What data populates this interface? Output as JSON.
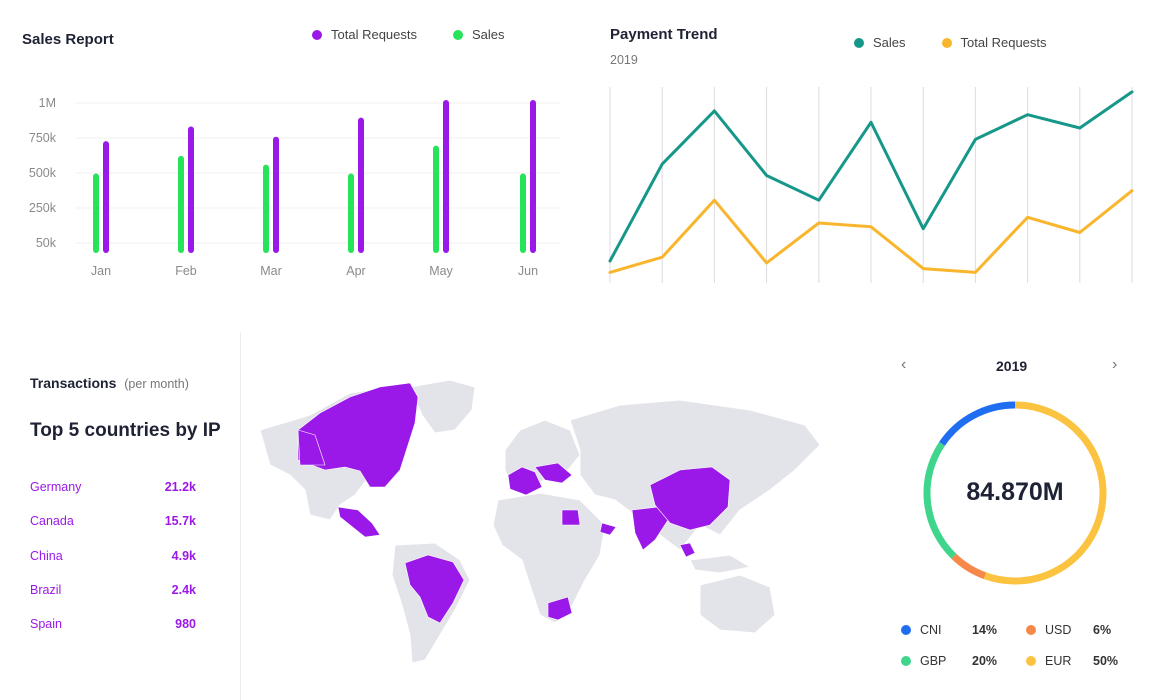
{
  "sales_report": {
    "title": "Sales Report",
    "legend": [
      {
        "label": "Total Requests",
        "color": "#9b19e8"
      },
      {
        "label": "Sales",
        "color": "#27e35a"
      }
    ]
  },
  "payment_trend": {
    "title": "Payment Trend",
    "subtitle": "2019",
    "legend": [
      {
        "label": "Sales",
        "color": "#16978a"
      },
      {
        "label": "Total Requests",
        "color": "#f9b52c"
      }
    ]
  },
  "chart_data": [
    {
      "type": "bar",
      "title": "Sales Report",
      "categories": [
        "Jan",
        "Feb",
        "Mar",
        "Apr",
        "May",
        "Jun"
      ],
      "yticks": [
        "50k",
        "250k",
        "500k",
        "750k",
        "1M"
      ],
      "ylim": [
        0,
        1000000
      ],
      "grid": true,
      "legend_position": "top",
      "series": [
        {
          "name": "Sales",
          "color": "#27e35a",
          "values": [
            500000,
            620000,
            560000,
            500000,
            690000,
            500000
          ]
        },
        {
          "name": "Total Requests",
          "color": "#9b19e8",
          "values": [
            720000,
            820000,
            750000,
            880000,
            1000000,
            1000000
          ]
        }
      ]
    },
    {
      "type": "line",
      "title": "Payment Trend",
      "subtitle": "2019",
      "grid": "vertical",
      "legend_position": "top",
      "x": [
        1,
        2,
        3,
        4,
        5,
        6,
        7,
        8,
        9,
        10,
        11
      ],
      "ylim": [
        0,
        100
      ],
      "series": [
        {
          "name": "Sales",
          "color": "#16978a",
          "values": [
            10,
            61,
            89,
            55,
            42,
            83,
            27,
            74,
            87,
            80,
            99
          ]
        },
        {
          "name": "Total Requests",
          "color": "#f9b52c",
          "values": [
            4,
            12,
            42,
            9,
            30,
            28,
            6,
            4,
            33,
            25,
            47
          ]
        }
      ]
    },
    {
      "type": "pie",
      "title": "2019",
      "center_value": "84.870M",
      "slices": [
        {
          "label": "CNI",
          "value": 14,
          "pct": "14%",
          "color": "#1f6ef2"
        },
        {
          "label": "GBP",
          "value": 20,
          "pct": "20%",
          "color": "#3fd58d"
        },
        {
          "label": "USD",
          "value": 6,
          "pct": "6%",
          "color": "#f6894a"
        },
        {
          "label": "EUR",
          "value": 50,
          "pct": "50%",
          "color": "#fbc33f"
        }
      ]
    }
  ],
  "transactions": {
    "label": "Transactions",
    "sublabel": "(per month)",
    "heading": "Top 5 countries by IP",
    "countries": [
      {
        "name": "Germany",
        "value": "21.2k"
      },
      {
        "name": "Canada",
        "value": "15.7k"
      },
      {
        "name": "China",
        "value": "4.9k"
      },
      {
        "name": "Brazil",
        "value": "2.4k"
      },
      {
        "name": "Spain",
        "value": "980"
      }
    ]
  },
  "map": {
    "land_color": "#e3e3ea",
    "highlight_color": "#9b19e8"
  },
  "donut": {
    "year": "2019",
    "prev_icon": "chevron-left-icon",
    "next_icon": "chevron-right-icon"
  }
}
